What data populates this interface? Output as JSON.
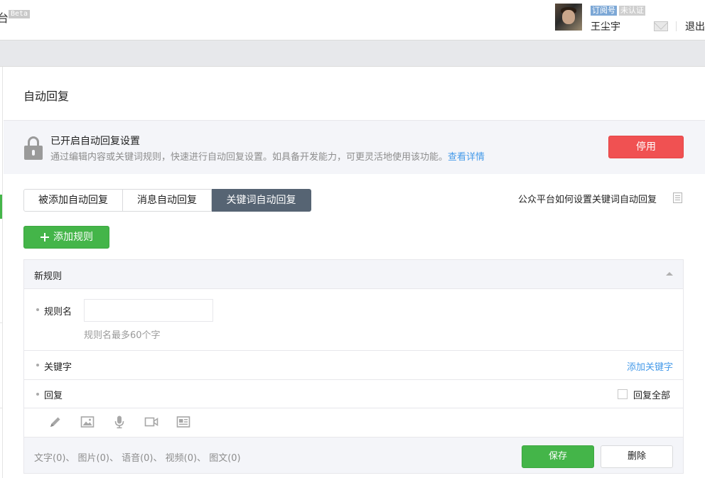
{
  "header": {
    "brand_partial": "台",
    "beta": "Beta",
    "tag_subscription": "订阅号",
    "tag_unverified": "未认证",
    "username": "王尘宇",
    "logout": "退出"
  },
  "page": {
    "title": "自动回复"
  },
  "notice": {
    "title": "已开启自动回复设置",
    "desc": "通过编辑内容或关键词规则，快速进行自动回复设置。如具备开发能力，可更灵活地使用该功能。",
    "link": "查看详情",
    "stop_button": "停用"
  },
  "tabs": [
    {
      "label": "被添加自动回复",
      "active": false
    },
    {
      "label": "消息自动回复",
      "active": false
    },
    {
      "label": "关键词自动回复",
      "active": true
    }
  ],
  "help_link": "公众平台如何设置关键词自动回复",
  "add_rule_button": "添加规则",
  "rule": {
    "header": "新规则",
    "name_label": "规则名",
    "name_value": "",
    "name_hint": "规则名最多60个字",
    "keyword_label": "关键字",
    "add_keyword": "添加关键字",
    "reply_label": "回复",
    "reply_all_label": "回复全部",
    "reply_all_checked": false,
    "reply_types": [
      "pencil-icon",
      "image-icon",
      "microphone-icon",
      "video-icon",
      "news-icon"
    ],
    "counts": "文字(0)、 图片(0)、 语音(0)、 视频(0)、 图文(0)",
    "save_button": "保存",
    "delete_button": "删除"
  },
  "colors": {
    "primary_green": "#44b549",
    "danger_red": "#f05152",
    "active_tab": "#566473",
    "link_blue": "#459ae9"
  }
}
